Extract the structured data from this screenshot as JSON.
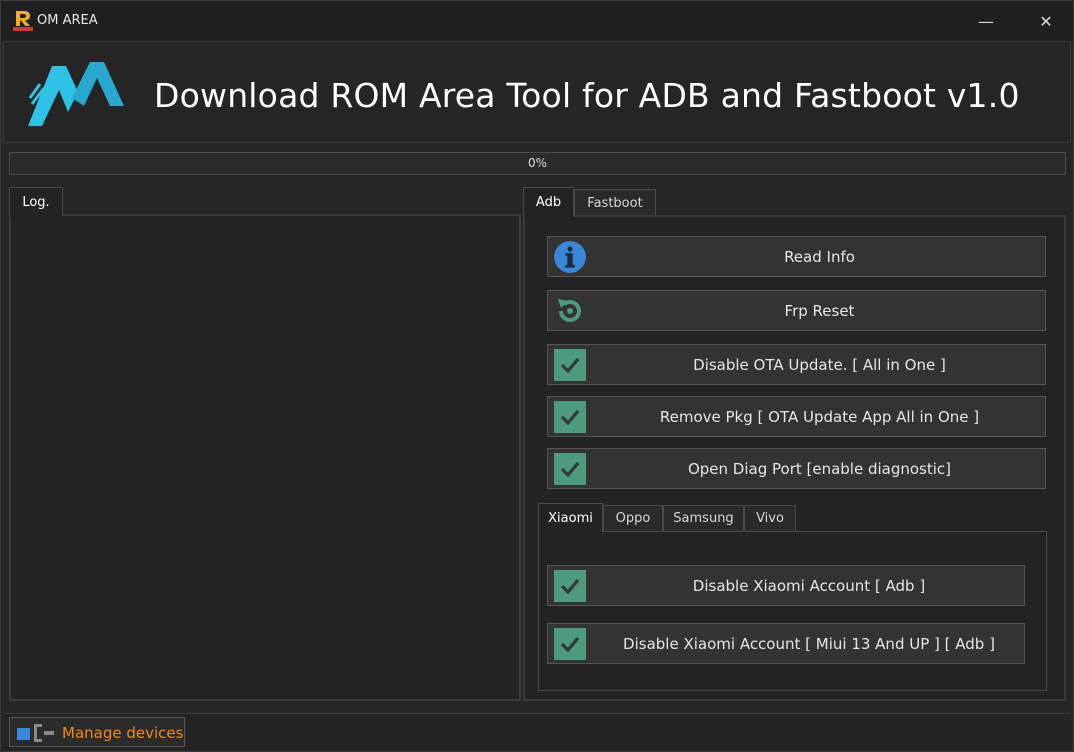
{
  "window": {
    "title": "OM AREA",
    "minimize_glyph": "—",
    "close_glyph": "✕"
  },
  "banner": {
    "title": "Download ROM Area Tool for ADB and Fastboot v1.0",
    "logo_icon": "rom-area-logo"
  },
  "progress": {
    "value": 0,
    "label": "0%"
  },
  "log": {
    "tab_label": "Log.",
    "content": ""
  },
  "main_tabs": [
    {
      "label": "Adb",
      "active": true
    },
    {
      "label": "Fastboot",
      "active": false
    }
  ],
  "adb_actions": [
    {
      "label": "Read Info",
      "icon": "info-icon"
    },
    {
      "label": "Frp Reset",
      "icon": "refresh-icon"
    },
    {
      "label": "Disable OTA Update. [ All in One ]",
      "icon": "check-icon"
    },
    {
      "label": "Remove Pkg [ OTA Update App  All in One ]",
      "icon": "check-icon"
    },
    {
      "label": "Open Diag Port [enable diagnostic]",
      "icon": "check-icon"
    }
  ],
  "brand_tabs": [
    {
      "label": "Xiaomi",
      "active": true
    },
    {
      "label": "Oppo",
      "active": false
    },
    {
      "label": "Samsung",
      "active": false
    },
    {
      "label": "Vivo",
      "active": false
    }
  ],
  "xiaomi_actions": [
    {
      "label": "Disable Xiaomi Account  [ Adb ]",
      "icon": "check-icon"
    },
    {
      "label": "Disable Xiaomi Account  [ Miui 13 And UP ] [ Adb ]",
      "icon": "check-icon"
    }
  ],
  "footer": {
    "manage_label": "Manage devices",
    "manage_icon": "devices-icon"
  },
  "colors": {
    "accent_blue": "#3d7fd6",
    "check_green": "#4e9a7c",
    "manage_orange": "#f08a1c",
    "logo_cyan": "#2fc1e6"
  }
}
